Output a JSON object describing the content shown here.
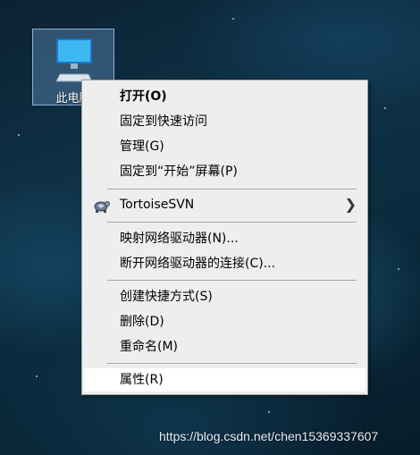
{
  "desktop": {
    "icon_label": "此电脑"
  },
  "context_menu": {
    "open": "打开(O)",
    "pin_quick_access": "固定到快速访问",
    "manage": "管理(G)",
    "pin_start": "固定到“开始”屏幕(P)",
    "tortoise_svn": "TortoiseSVN",
    "map_drive": "映射网络驱动器(N)...",
    "disconnect_drive": "断开网络驱动器的连接(C)...",
    "create_shortcut": "创建快捷方式(S)",
    "delete": "删除(D)",
    "rename": "重命名(M)",
    "properties": "属性(R)"
  },
  "watermark": "https://blog.csdn.net/chen15369337607",
  "colors": {
    "menu_bg": "#eeeeee",
    "menu_hover": "#ffffff",
    "selection": "#78aadc"
  }
}
